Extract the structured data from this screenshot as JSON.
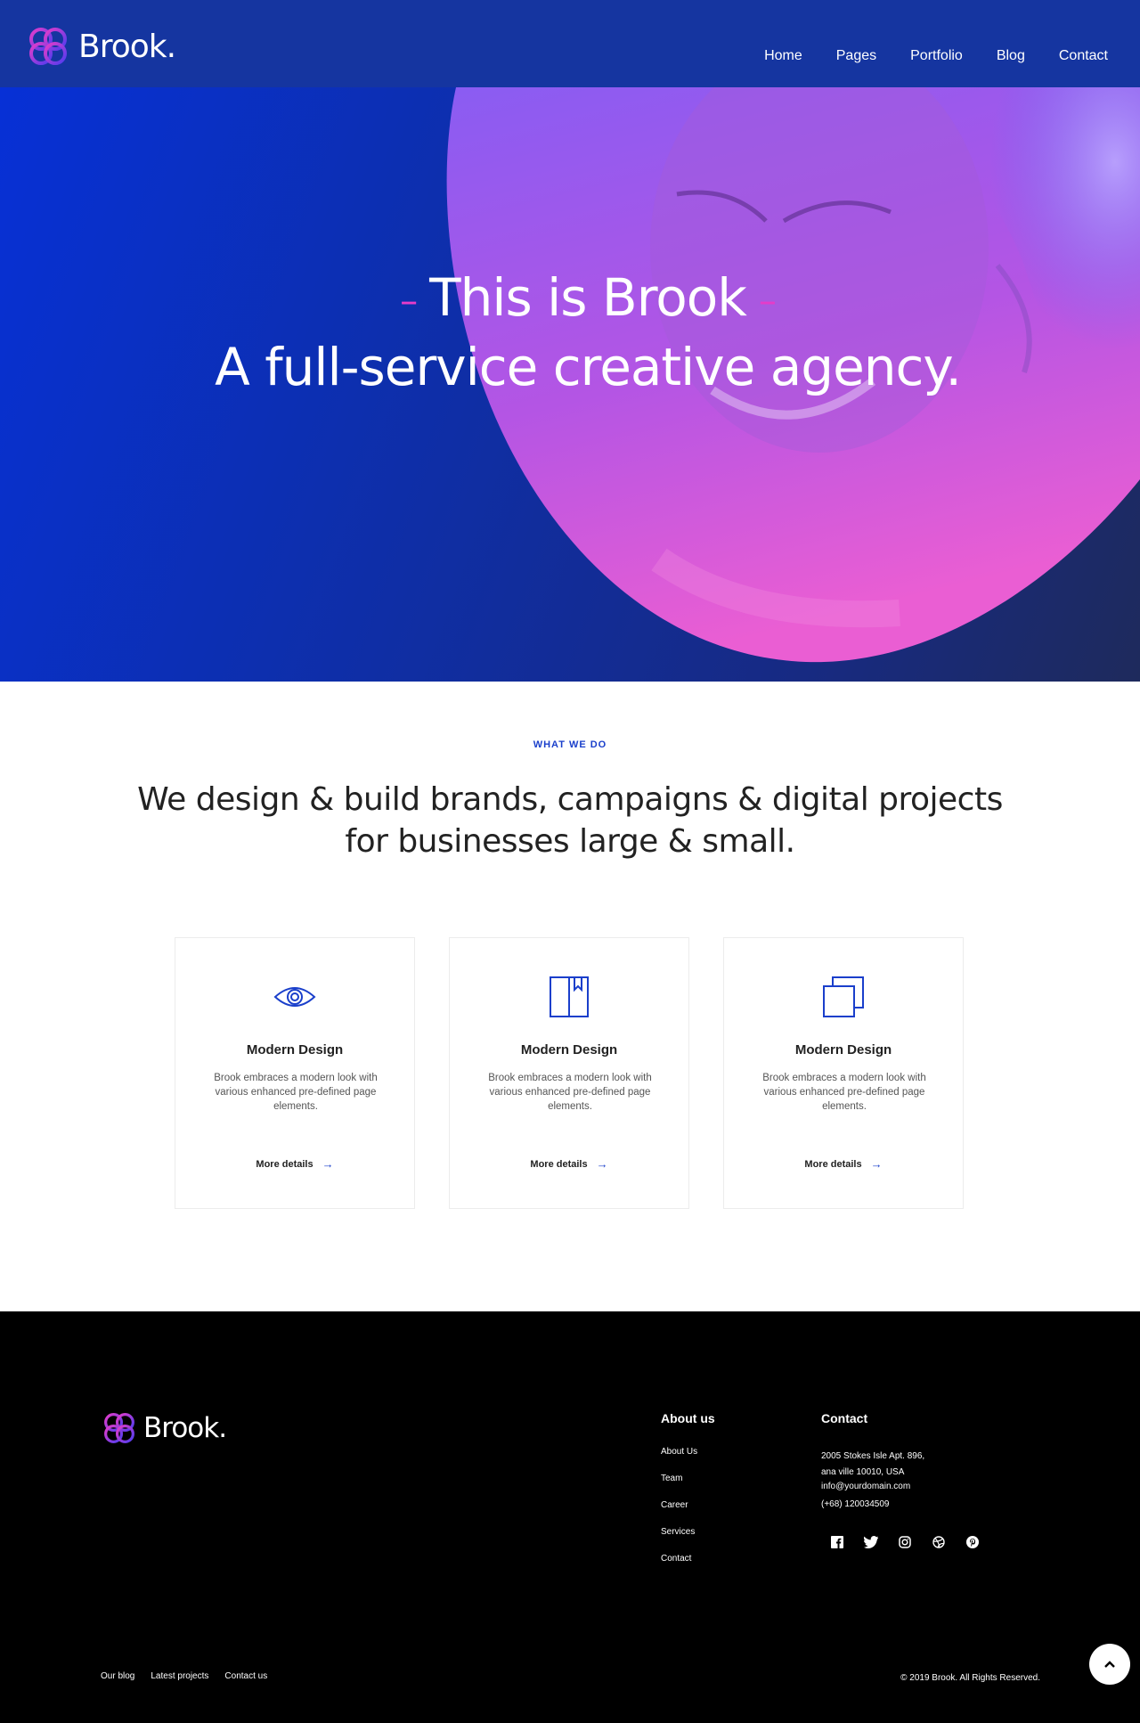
{
  "brand": {
    "name": "Brook.",
    "logo_icon": "brook-knot-logo",
    "accent": "#1a3fcb",
    "pink": "#e53cc9"
  },
  "nav": {
    "items": [
      "Home",
      "Pages",
      "Portfolio",
      "Blog",
      "Contact"
    ]
  },
  "hero": {
    "line1": "This is Brook",
    "line2": "A full-service creative agency.",
    "gradient": [
      "#0730d6",
      "#1e2a5c"
    ],
    "image_tint": [
      "#9b5cf0",
      "#e85ed1"
    ]
  },
  "services": {
    "eyebrow": "WHAT WE DO",
    "headline_1": "We design & build brands, campaigns & digital projects",
    "headline_2": "for businesses large & small.",
    "cards": [
      {
        "icon": "eye-icon",
        "title": "Modern Design",
        "desc": "Brook embraces a modern look with various enhanced pre-defined page elements.",
        "link": "More details"
      },
      {
        "icon": "book-icon",
        "title": "Modern Design",
        "desc": "Brook embraces a modern look with various enhanced pre-defined page elements.",
        "link": "More details"
      },
      {
        "icon": "copy-icon",
        "title": "Modern Design",
        "desc": "Brook embraces a modern look with various enhanced pre-defined page elements.",
        "link": "More details"
      }
    ]
  },
  "footer": {
    "about_title": "About us",
    "about_links": [
      "About Us",
      "Team",
      "Career",
      "Services",
      "Contact"
    ],
    "contact_title": "Contact",
    "address_1": "2005 Stokes Isle Apt. 896,",
    "address_2": "ana ville 10010, USA",
    "email": "info@yourdomain.com",
    "phone": "(+68) 120034509",
    "socials": [
      "facebook-icon",
      "twitter-icon",
      "instagram-icon",
      "dribbble-icon",
      "pinterest-icon"
    ],
    "bottom_links": [
      "Our blog",
      "Latest projects",
      "Contact us"
    ],
    "copyright": "© 2019 Brook. All Rights Reserved."
  }
}
